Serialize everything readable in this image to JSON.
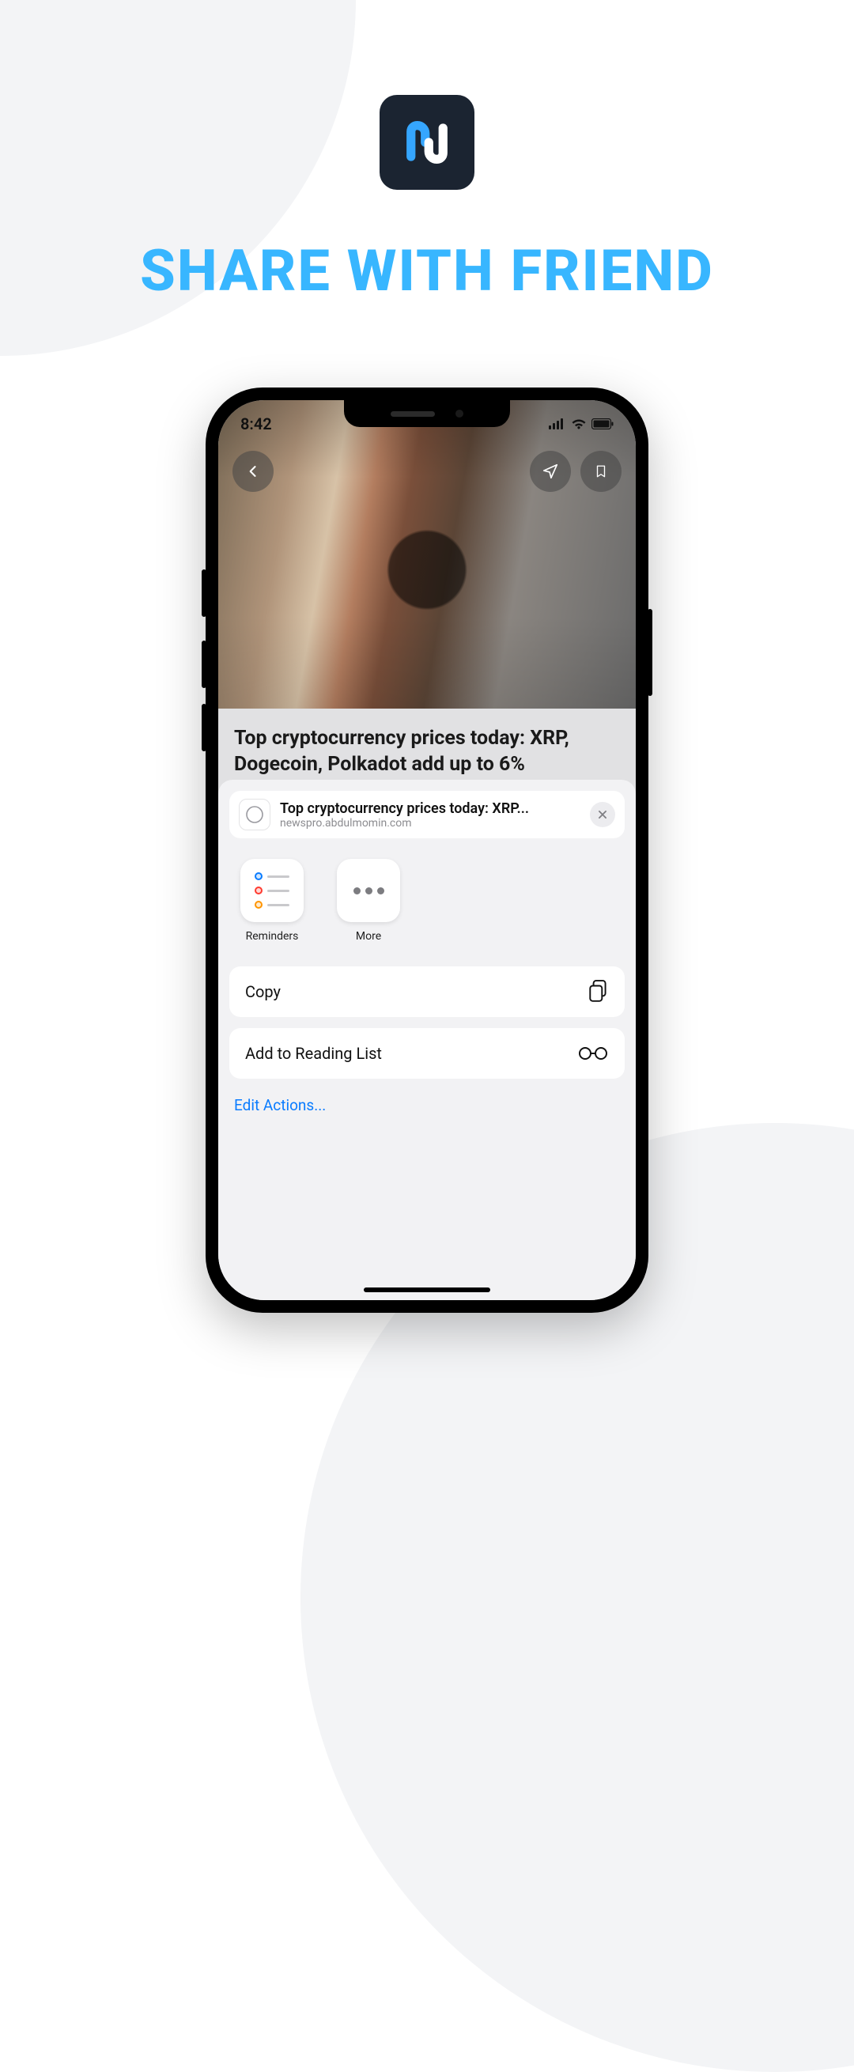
{
  "headline": "SHARE WITH FRIEND",
  "status": {
    "time": "8:42"
  },
  "article": {
    "title": "Top cryptocurrency prices today: XRP, Dogecoin, Polkadot add up to 6%"
  },
  "sheet": {
    "title": "Top cryptocurrency prices today: XRP...",
    "subtitle": "newspro.abdulmomin.com",
    "apps": {
      "reminders": "Reminders",
      "more": "More"
    },
    "actions": {
      "copy": "Copy",
      "reading_list": "Add to Reading List"
    },
    "edit": "Edit Actions..."
  }
}
